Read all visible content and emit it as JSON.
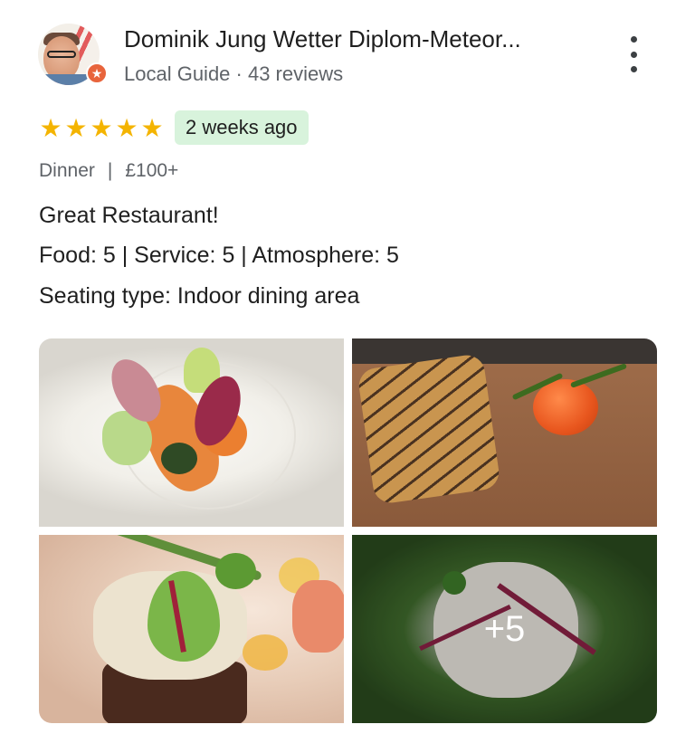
{
  "review": {
    "author_name": "Dominik Jung Wetter Diplom-Meteor...",
    "author_meta": "Local Guide · 43 reviews",
    "star_rating": 5,
    "stars": [
      "★",
      "★",
      "★",
      "★",
      "★"
    ],
    "time_ago": "2 weeks ago",
    "visit_meal": "Dinner",
    "visit_separator": "|",
    "visit_price": "£100+",
    "text": "Great Restaurant!",
    "ratings": {
      "food_label": "Food",
      "food_value": ": 5 | ",
      "service_label": "Service",
      "service_value": ": 5 | ",
      "atmosphere_label": "Atmosphere",
      "atmosphere_value": ": 5"
    },
    "seating": {
      "label": "Seating type",
      "value": ": Indoor dining area"
    },
    "more_photos_count": "+5",
    "badge_icon": "local-guide-star-icon",
    "menu_icon": "more-vertical-icon"
  },
  "colors": {
    "star": "#f4b400",
    "time_chip_bg": "#d8f3dc",
    "badge": "#e8643c",
    "secondary_text": "#5f6368"
  }
}
